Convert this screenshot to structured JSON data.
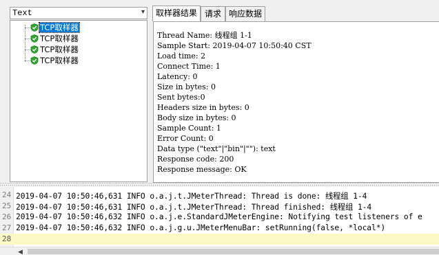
{
  "renderer": {
    "selected": "Text"
  },
  "tree": {
    "items": [
      {
        "label": "TCP取样器",
        "selected": true
      },
      {
        "label": "TCP取样器",
        "selected": false
      },
      {
        "label": "TCP取样器",
        "selected": false
      },
      {
        "label": "TCP取样器",
        "selected": false
      }
    ]
  },
  "tabs": [
    {
      "label": "取样器结果",
      "active": true
    },
    {
      "label": "请求",
      "active": false
    },
    {
      "label": "响应数据",
      "active": false
    }
  ],
  "sampler_result": {
    "lines": [
      "Thread Name: 线程组 1-1",
      "Sample Start: 2019-04-07 10:50:40 CST",
      "Load time: 2",
      "Connect Time: 1",
      "Latency: 0",
      "Size in bytes: 0",
      "Sent bytes:0",
      "Headers size in bytes: 0",
      "Body size in bytes: 0",
      "Sample Count: 1",
      "Error Count: 0",
      "Data type (\"text\"|\"bin\"|\"\"): text",
      "Response code: 200",
      "Response message: OK"
    ]
  },
  "log": {
    "lines": [
      {
        "num": "24",
        "text": "2019-04-07 10:50:46,631 INFO o.a.j.t.JMeterThread: Thread is done: 线程组 1-4"
      },
      {
        "num": "25",
        "text": "2019-04-07 10:50:46,631 INFO o.a.j.t.JMeterThread: Thread finished: 线程组 1-4"
      },
      {
        "num": "26",
        "text": "2019-04-07 10:50:46,632 INFO o.a.j.e.StandardJMeterEngine: Notifying test listeners of e"
      },
      {
        "num": "27",
        "text": "2019-04-07 10:50:46,632 INFO o.a.j.g.u.JMeterMenuBar: setRunning(false, *local*)"
      },
      {
        "num": "28",
        "text": ""
      }
    ]
  },
  "colors": {
    "selection": "#0078d7",
    "current_line": "#fbf8c4",
    "success_icon": "#2fa82f"
  },
  "icons": {
    "tree_item": "green-checkmark-shield-icon",
    "dropdown": "chevron-down-icon",
    "scroll_left": "scroll-left-arrow-icon"
  }
}
